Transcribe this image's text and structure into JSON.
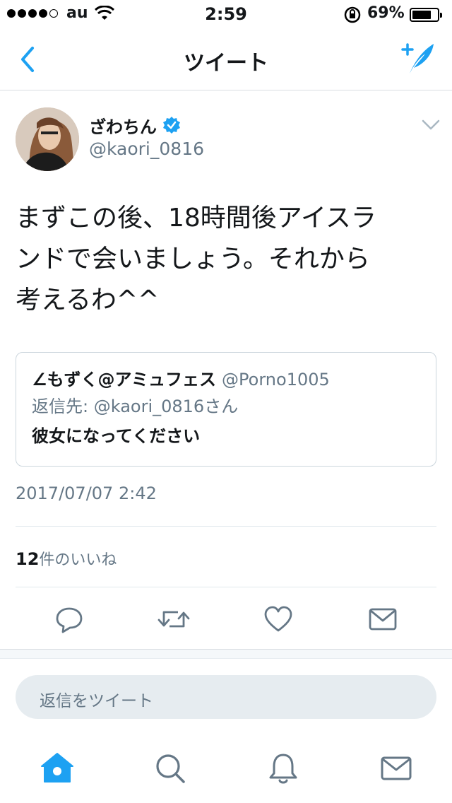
{
  "status_bar": {
    "carrier": "au",
    "time": "2:59",
    "battery": "69%",
    "battery_level": 0.69,
    "signal_bars": 4
  },
  "nav": {
    "title": "ツイート",
    "back_icon": "chevron-left-icon",
    "compose_icon": "compose-tweet-icon",
    "accent_color": "#1da1f2"
  },
  "tweet": {
    "display_name": "ざわちん",
    "verified": true,
    "handle": "@kaori_0816",
    "text_lines": [
      "まずこの後、18時間後アイスラ",
      "ンドで会いましょう。それから",
      "考えるわ^^"
    ],
    "quoted": {
      "name": "∠もずく@アミュフェス",
      "handle": "@Porno1005",
      "reply_to_label": "返信先: @kaori_0816さん",
      "text": "彼女になってください"
    },
    "timestamp": "2017/07/07 2:42",
    "likes_count": "12",
    "likes_label": "件のいいね"
  },
  "actions": [
    "reply-icon",
    "retweet-icon",
    "like-icon",
    "message-icon"
  ],
  "reply_bar": {
    "placeholder": "返信をツイート"
  },
  "tab_bar": [
    "home-icon",
    "search-icon",
    "notifications-icon",
    "messages-icon"
  ],
  "colors": {
    "blue": "#1da1f2",
    "gray": "#657786",
    "text": "#14171a"
  }
}
